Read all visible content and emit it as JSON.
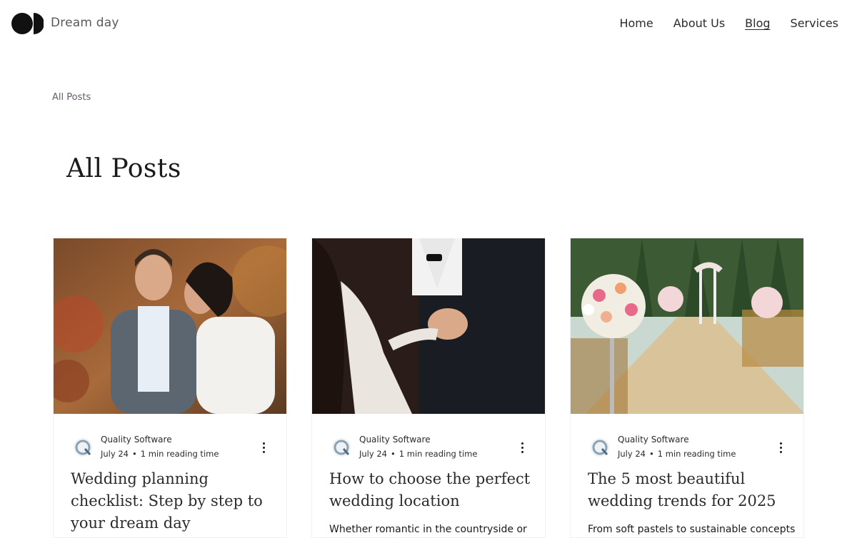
{
  "header": {
    "brand": "Dream day",
    "nav": [
      {
        "label": "Home"
      },
      {
        "label": "About Us"
      },
      {
        "label": "Blog"
      },
      {
        "label": "Services"
      }
    ]
  },
  "breadcrumb": "All Posts",
  "page_title": "All Posts",
  "posts": [
    {
      "image": "couple-portrait-image",
      "author": "Quality Software",
      "date": "July 24",
      "separator": "•",
      "reading_time": "1 min reading time",
      "title": "Wedding planning checklist: Step by step to your dream day",
      "excerpt": ""
    },
    {
      "image": "couple-dancing-image",
      "author": "Quality Software",
      "date": "July 24",
      "separator": "•",
      "reading_time": "1 min reading time",
      "title": "How to choose the perfect wedding location",
      "excerpt": "Whether romantic in the countryside or"
    },
    {
      "image": "outdoor-ceremony-image",
      "author": "Quality Software",
      "date": "July 24",
      "separator": "•",
      "reading_time": "1 min reading time",
      "title": "The 5 most beautiful wedding trends for 2025",
      "excerpt": "From soft pastels to sustainable concepts"
    }
  ],
  "colors": {
    "brand_text": "#5a5a5a",
    "breadcrumb": "#6a5a6a",
    "avatar": "#8aa2b4"
  }
}
